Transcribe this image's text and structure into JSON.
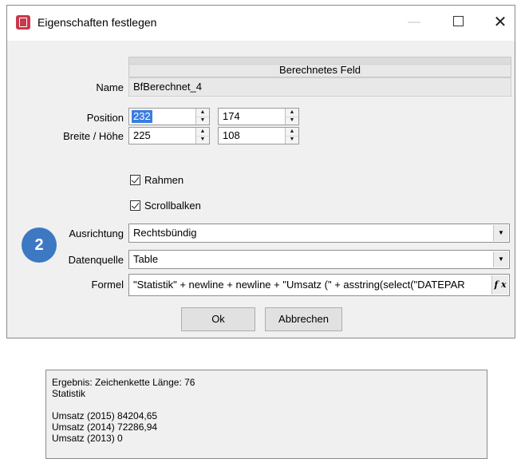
{
  "dialog": {
    "title": "Eigenschaften festlegen",
    "controls": {
      "minimize": "—",
      "close": "✕"
    }
  },
  "header": {
    "text": "Berechnetes Feld"
  },
  "fields": {
    "name_label": "Name",
    "name_value": "BfBerechnet_4",
    "position_label": "Position",
    "position_x": "232",
    "position_y": "174",
    "size_label": "Breite / Höhe",
    "width": "225",
    "height": "108",
    "frame_label": "Rahmen",
    "frame_checked": true,
    "scrollbars_label": "Scrollbalken",
    "scrollbars_checked": true,
    "alignment_label": "Ausrichtung",
    "alignment_value": "Rechtsbündig",
    "datasource_label": "Datenquelle",
    "datasource_value": "Table",
    "formula_label": "Formel",
    "formula_value": "\"Statistik\" + newline + newline + \"Umsatz (\" +  asstring(select(\"DATEPAR",
    "formula_button": "f x"
  },
  "badge": {
    "text": "2",
    "color": "#3d78c3"
  },
  "buttons": {
    "ok": "Ok",
    "cancel": "Abbrechen"
  },
  "result": {
    "lines": [
      "Ergebnis: Zeichenkette Länge: 76",
      "Statistik",
      "",
      "Umsatz (2015) 84204,65",
      "Umsatz (2014) 72286,94",
      "Umsatz (2013) 0"
    ]
  },
  "colors": {
    "selection": "#3a7de0",
    "window_bg": "#f0f0f0",
    "app_icon": "#c9384b"
  }
}
